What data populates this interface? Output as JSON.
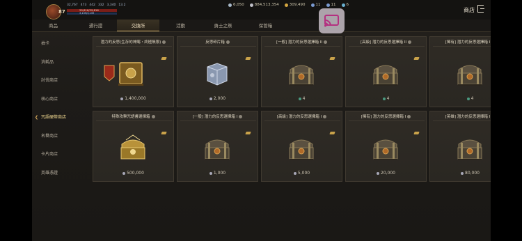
{
  "hud": {
    "level": "87",
    "stats": [
      "32,767",
      "473",
      "442",
      "332",
      "3,340",
      "13.2"
    ],
    "hp_text": "29,816/29,816",
    "mp_text": "3,139/3,139",
    "currencies": [
      {
        "icon": "gem-icon",
        "color": "#a8b8c8",
        "value": "6,050"
      },
      {
        "icon": "silver-coin-icon",
        "color": "#c0c0c8",
        "value": "884,513,354"
      },
      {
        "icon": "gold-coin-icon",
        "color": "#d4a640",
        "value": "309,490"
      },
      {
        "icon": "token-icon",
        "color": "#7a9ad0",
        "value": "11"
      },
      {
        "icon": "token-icon",
        "color": "#7a9ad0",
        "value": "11"
      },
      {
        "icon": "medal-icon",
        "color": "#6ab0d0",
        "value": "6"
      }
    ],
    "shop_title": "商店"
  },
  "tabs": [
    {
      "label": "商品",
      "active": false
    },
    {
      "label": "通行證",
      "active": false
    },
    {
      "label": "交換所",
      "active": true
    },
    {
      "label": "活動",
      "active": false
    },
    {
      "label": "勇士之祭",
      "active": false
    },
    {
      "label": "保管箱",
      "active": false
    }
  ],
  "sidebar": [
    {
      "label": "抽卡",
      "active": false
    },
    {
      "label": "消耗品",
      "active": false
    },
    {
      "label": "討伐商店",
      "active": false
    },
    {
      "label": "核心商店",
      "active": false
    },
    {
      "label": "咒語硬幣商店",
      "active": true
    },
    {
      "label": "名譽商店",
      "active": false
    },
    {
      "label": "卡片商店",
      "active": false
    },
    {
      "label": "英雄憑證",
      "active": false
    }
  ],
  "items": [
    {
      "title": "潛力的反思(生存的神賜・終極無限)",
      "price": "1,400,000",
      "art": "book",
      "coin": "silver"
    },
    {
      "title": "反思碎片箱",
      "price": "2,000",
      "art": "box",
      "coin": "silver"
    },
    {
      "title": "[一般] 潛力的反思選擇箱 II",
      "price": "4",
      "art": "chest",
      "coin": "green"
    },
    {
      "title": "[高級] 潛力的反思選擇箱 II",
      "price": "4",
      "art": "chest",
      "coin": "green"
    },
    {
      "title": "[稀有] 潛力的反思選擇箱 I",
      "price": "4",
      "art": "chest",
      "coin": "green"
    },
    {
      "title": "特殊攻擊咒語書選擇箱",
      "price": "500,000",
      "art": "goldchest",
      "coin": "silver"
    },
    {
      "title": "[一般] 潛力的反思選擇箱 I",
      "price": "1,000",
      "art": "chest",
      "coin": "silver"
    },
    {
      "title": "[高級] 潛力的反思選擇箱 I",
      "price": "5,000",
      "art": "chest",
      "coin": "silver"
    },
    {
      "title": "[稀有] 潛力的反思選擇箱 I",
      "price": "20,000",
      "art": "chest",
      "coin": "silver"
    },
    {
      "title": "[英雄] 潛力的反思選擇箱 I",
      "price": "80,000",
      "art": "chest",
      "coin": "silver"
    }
  ]
}
